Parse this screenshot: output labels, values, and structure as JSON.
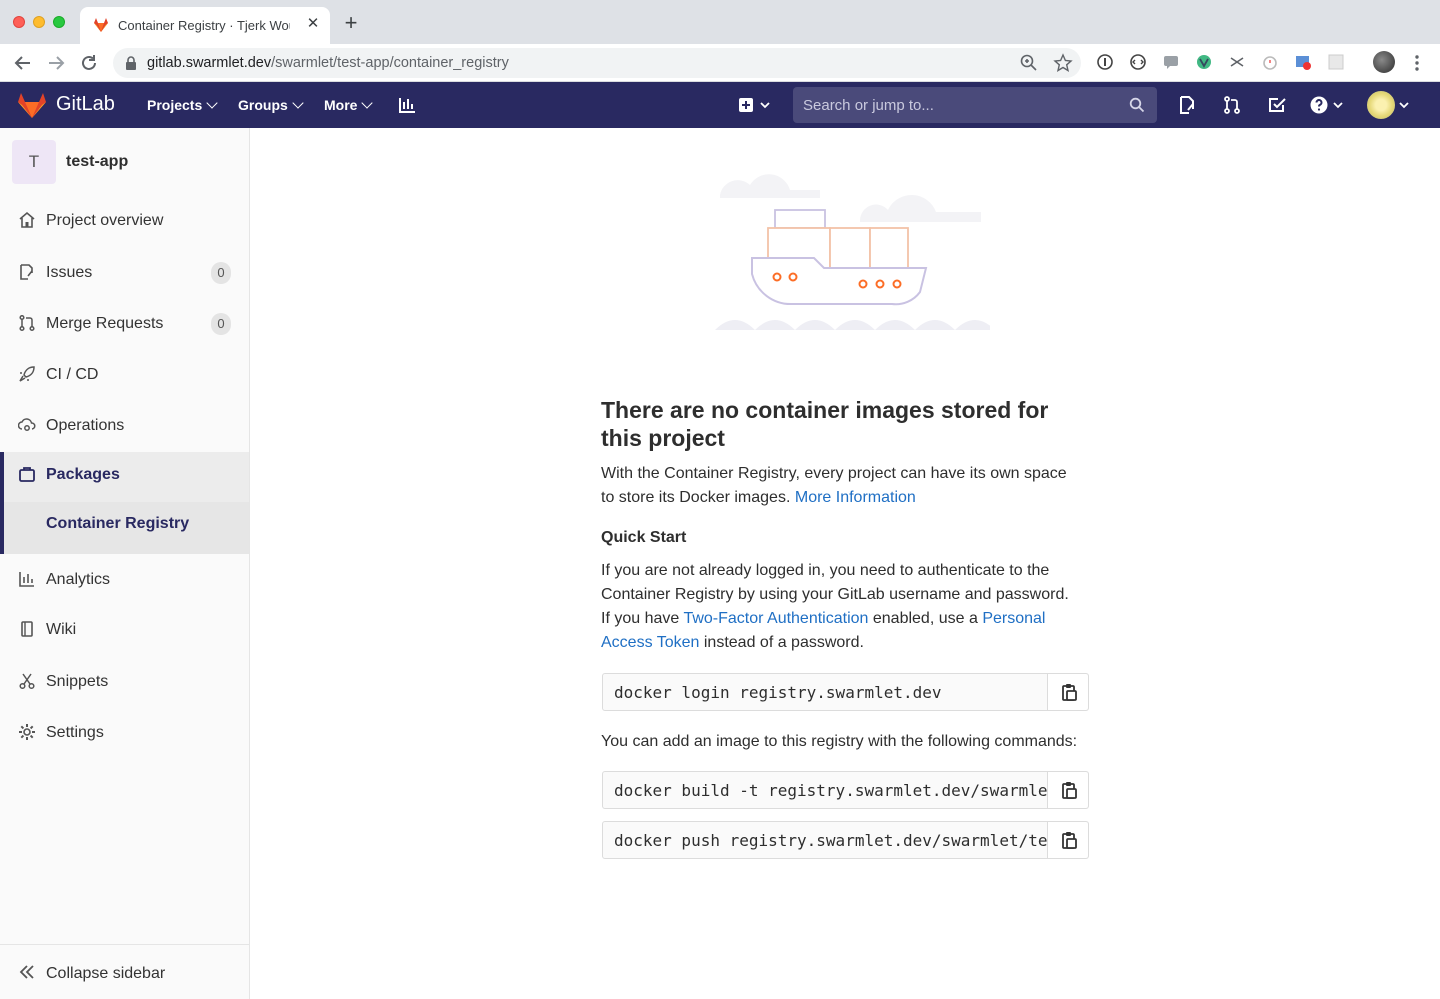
{
  "browser": {
    "tab_title": "Container Registry · Tjerk Woudsma",
    "url_host": "gitlab.swarmlet.dev",
    "url_path": "/swarmlet/test-app/container_registry"
  },
  "header": {
    "brand": "GitLab",
    "nav": [
      "Projects",
      "Groups",
      "More"
    ],
    "search_placeholder": "Search or jump to..."
  },
  "sidebar": {
    "project_initial": "T",
    "project_name": "test-app",
    "items": [
      {
        "label": "Project overview"
      },
      {
        "label": "Issues",
        "badge": "0"
      },
      {
        "label": "Merge Requests",
        "badge": "0"
      },
      {
        "label": "CI / CD"
      },
      {
        "label": "Operations"
      },
      {
        "label": "Packages"
      },
      {
        "label": "Analytics"
      },
      {
        "label": "Wiki"
      },
      {
        "label": "Snippets"
      },
      {
        "label": "Settings"
      }
    ],
    "sub_item": "Container Registry",
    "collapse": "Collapse sidebar"
  },
  "main": {
    "title": "There are no container images stored for this project",
    "intro": "With the Container Registry, every project can have its own space to store its Docker images.",
    "more_info": "More Information",
    "quick_start": "Quick Start",
    "auth_1": "If you are not already logged in, you need to authenticate to the Container Registry by using your GitLab username and password. If you have",
    "two_factor": "Two-Factor Authentication",
    "auth_2": "enabled, use a",
    "pat": "Personal Access Token",
    "auth_3": "instead of a password.",
    "login_cmd": "docker login registry.swarmlet.dev",
    "add_image": "You can add an image to this registry with the following commands:",
    "build_cmd": "docker build -t registry.swarmlet.dev/swarmlet/test-app .",
    "push_cmd": "docker push registry.swarmlet.dev/swarmlet/test-app"
  }
}
